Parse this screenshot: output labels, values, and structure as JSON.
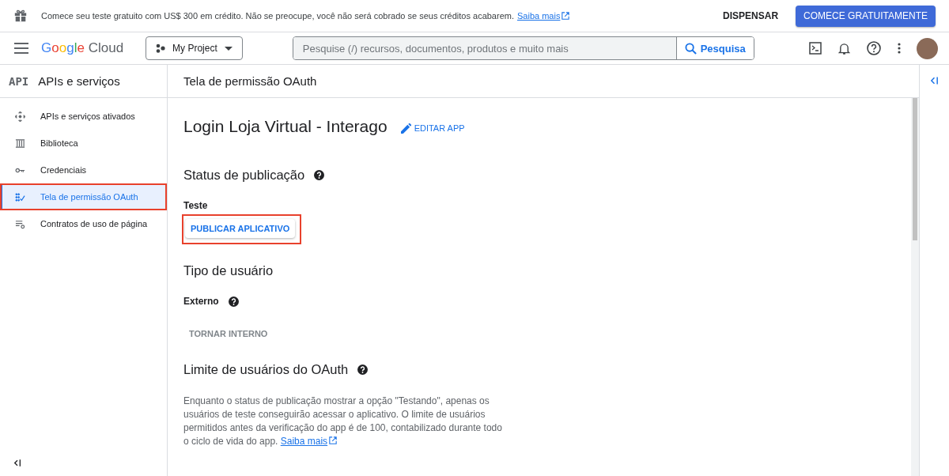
{
  "banner": {
    "message": "Comece seu teste gratuito com US$ 300 em crédito. Não se preocupe, você não será cobrado se seus créditos acabarem.",
    "link": "Saiba mais",
    "dismiss": "DISPENSAR",
    "cta": "COMECE GRATUITAMENTE"
  },
  "header": {
    "logo": "Google Cloud",
    "project": "My Project",
    "search": {
      "placeholder": "Pesquise (/) recursos, documentos, produtos e muito mais"
    },
    "search_button": "Pesquisa"
  },
  "sidebar": {
    "title": "APIs e serviços",
    "badge": "API",
    "items": [
      {
        "label": "APIs e serviços ativados",
        "selected": false,
        "highlighted": false
      },
      {
        "label": "Biblioteca",
        "selected": false,
        "highlighted": false
      },
      {
        "label": "Credenciais",
        "selected": false,
        "highlighted": false
      },
      {
        "label": "Tela de permissão OAuth",
        "selected": true,
        "highlighted": true
      },
      {
        "label": "Contratos de uso de página",
        "selected": false,
        "highlighted": false
      }
    ]
  },
  "page": {
    "title": "Tela de permissão OAuth",
    "app_name": "Login Loja Virtual - Interago",
    "edit": "EDITAR APP",
    "sections": [
      {
        "kind": "status",
        "heading": "Status de publicação",
        "help": true,
        "label": "Teste",
        "label_help": false,
        "button": "PUBLICAR APLICATIVO",
        "button_disabled": false,
        "highlighted": true
      },
      {
        "kind": "status",
        "heading": "Tipo de usuário",
        "help": false,
        "label": "Externo",
        "label_help": true,
        "button": "TORNAR INTERNO",
        "button_disabled": true,
        "highlighted": false
      },
      {
        "kind": "text",
        "heading": "Limite de usuários do OAuth",
        "help": true,
        "text": "Enquanto o status de publicação mostrar a opção \"Testando\", apenas os usuários de teste conseguirão acessar o aplicativo. O limite de usuários permitidos antes da verificação do app é de 100, contabilizado durante todo o ciclo de vida do app.",
        "link": "Saiba mais"
      }
    ]
  }
}
